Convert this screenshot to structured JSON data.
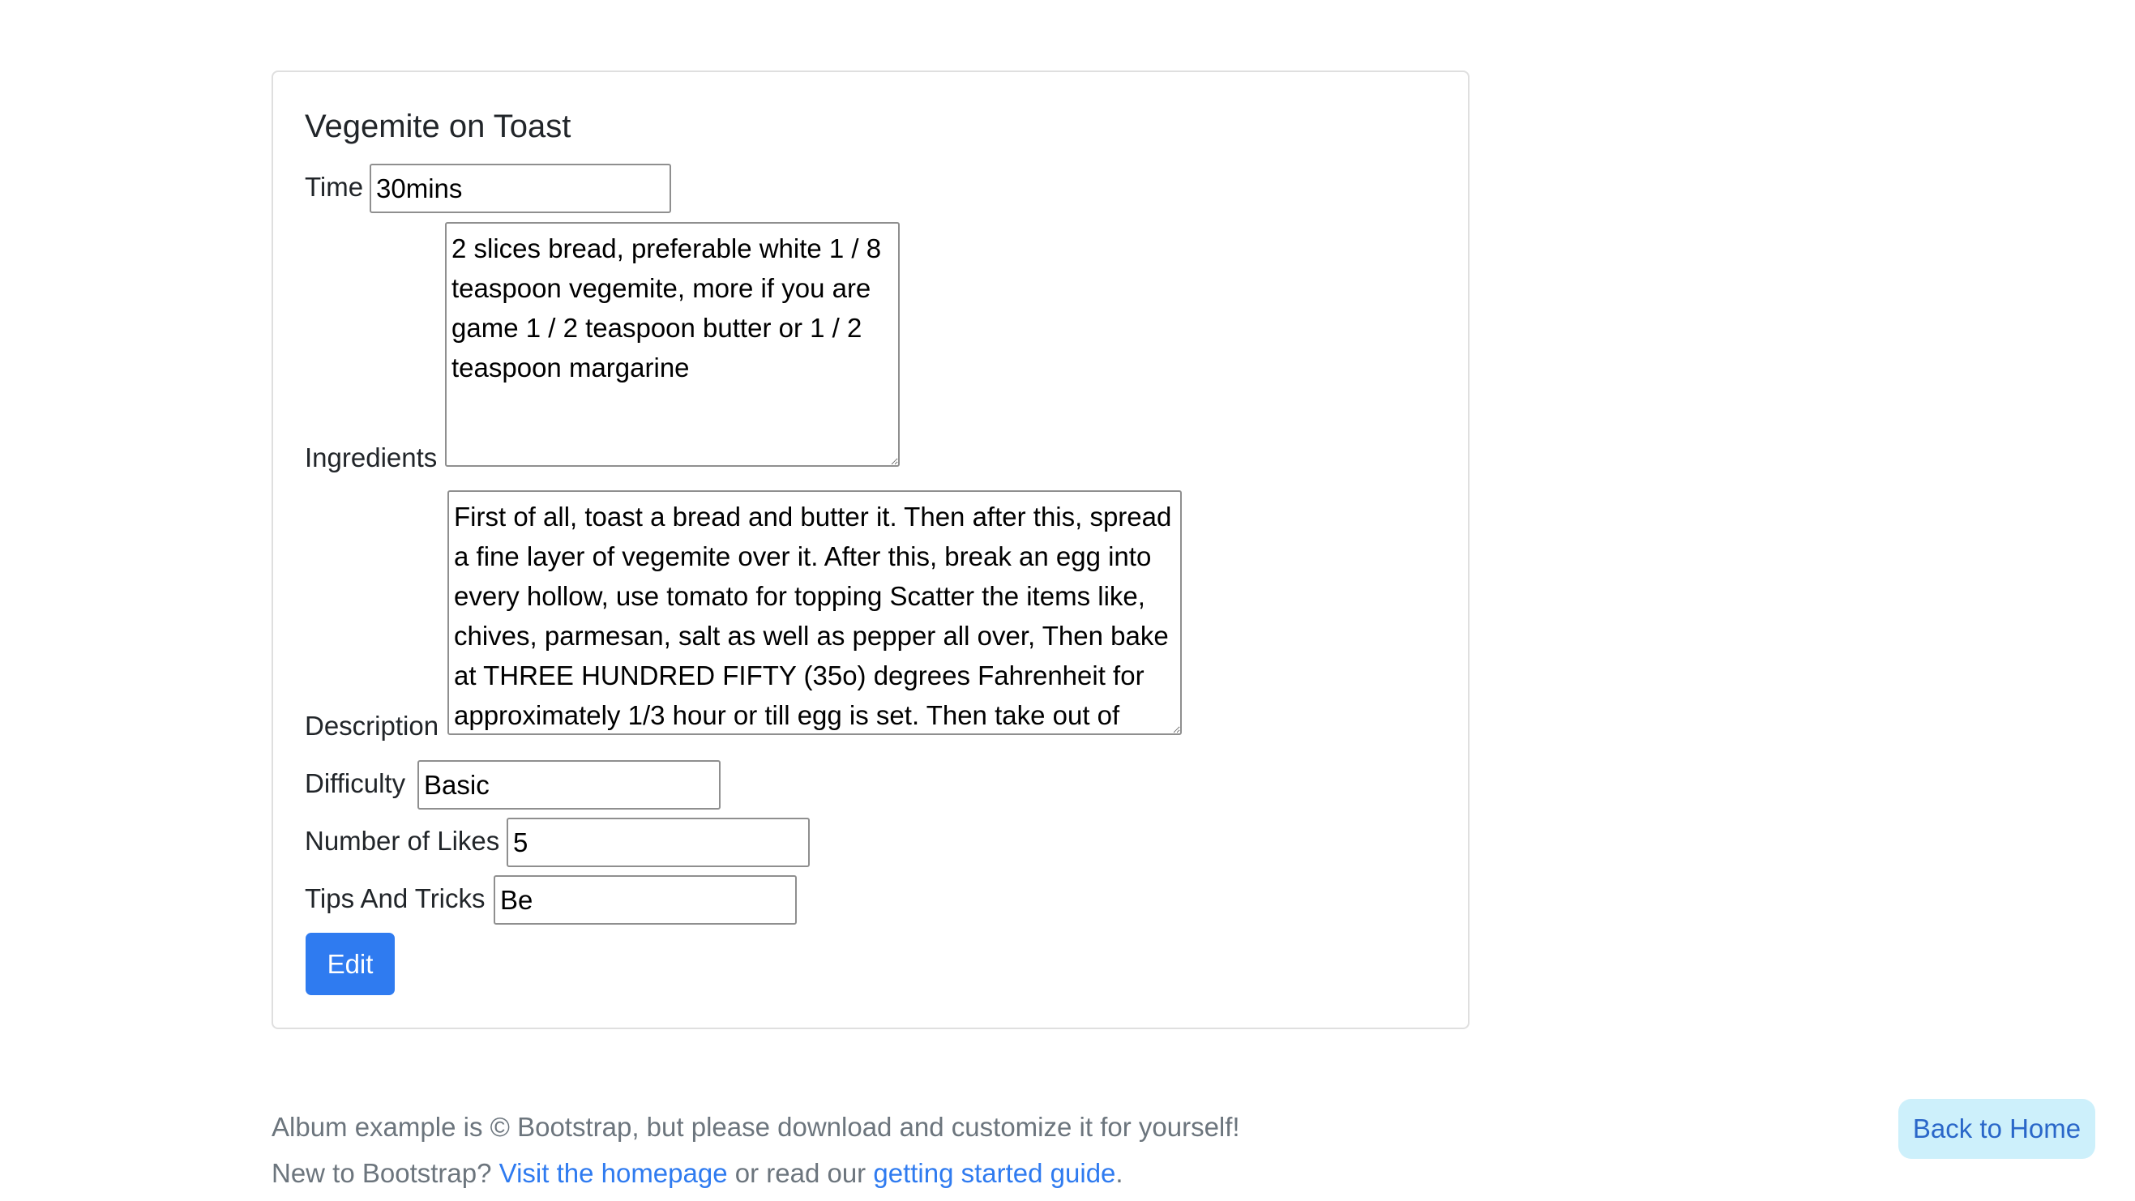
{
  "recipe": {
    "title": "Vegemite on Toast",
    "fields": {
      "time": {
        "label": "Time",
        "value": "30mins"
      },
      "ingredients": {
        "label": "Ingredients",
        "value": "2 slices bread, preferable white 1 / 8 teaspoon vegemite, more if you are game 1 / 2 teaspoon butter or 1 / 2 teaspoon margarine"
      },
      "description": {
        "label": "Description",
        "value": "First of all, toast a bread and butter it. Then after this, spread a fine layer of vegemite over it. After this, break an egg into every hollow, use tomato for topping Scatter the items like, chives, parmesan, salt as well as pepper all over, Then bake at THREE HUNDRED FIFTY (35o) degrees Fahrenheit for approximately 1/3 hour or till egg is set. Then take out of"
      },
      "difficulty": {
        "label": "Difficulty",
        "value": "Basic"
      },
      "likes": {
        "label": "Number of Likes",
        "value": "5"
      },
      "tips": {
        "label": "Tips And Tricks",
        "value": "Be"
      }
    },
    "edit_label": "Edit"
  },
  "footer": {
    "line1": "Album example is © Bootstrap, but please download and customize it for yourself!",
    "line2_prefix": "New to Bootstrap?",
    "homepage_link": "Visit the homepage",
    "line2_middle": "or read our",
    "guide_link": "getting started guide",
    "line2_suffix": ".",
    "back_home_label": "Back to Home"
  },
  "colors": {
    "primary": "#2f7bf0",
    "muted_text": "#6c757d",
    "info_light": "#cdf0fb"
  }
}
